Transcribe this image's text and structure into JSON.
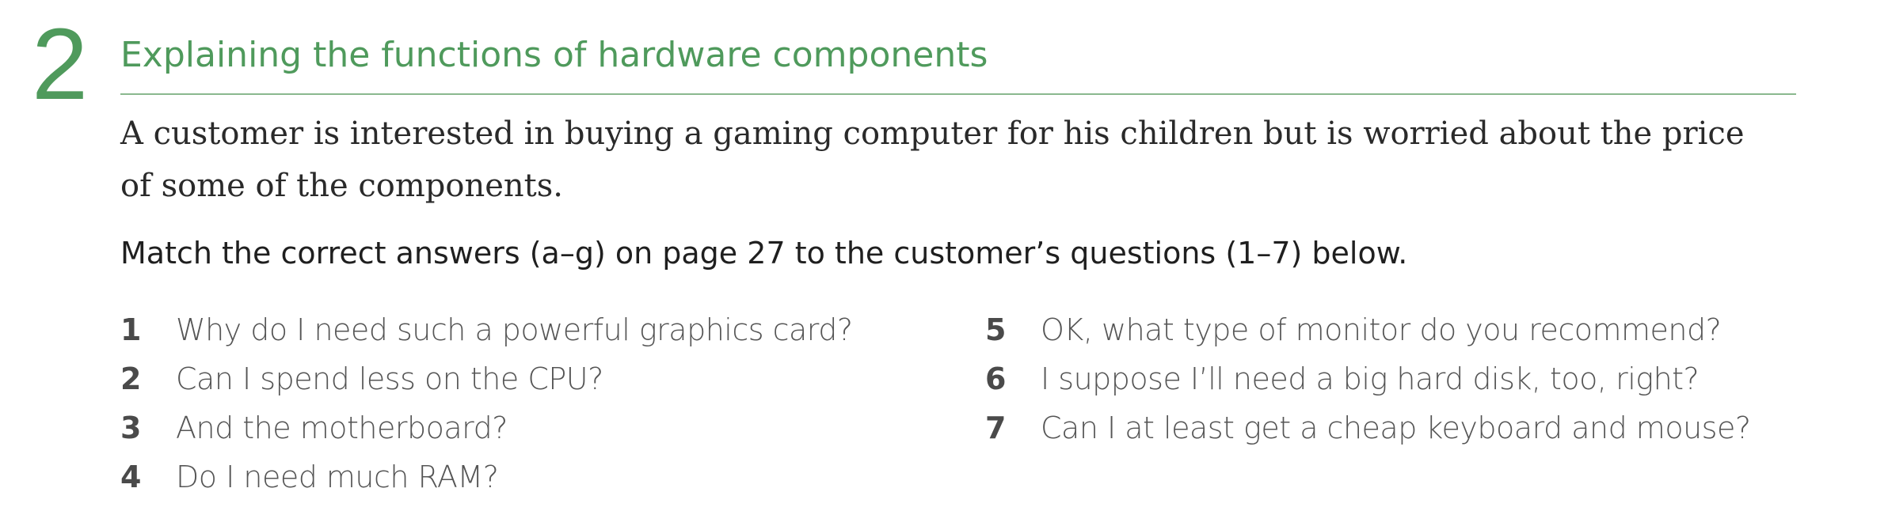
{
  "section": {
    "number": "2",
    "title": "Explaining the functions of hardware components",
    "accent_color": "#4f9a5c"
  },
  "intro": "A customer is interested in buying a gaming computer for his children but is worried about the price of some of the components.",
  "instruction": "Match the correct answers (a–g) on page 27 to the customer’s questions (1–7) below.",
  "questions_left": [
    {
      "num": "1",
      "text": "Why do I need such a powerful graphics card?"
    },
    {
      "num": "2",
      "text": "Can I spend less on the CPU?"
    },
    {
      "num": "3",
      "text": "And the motherboard?"
    },
    {
      "num": "4",
      "text": "Do I need much RAM?"
    }
  ],
  "questions_right": [
    {
      "num": "5",
      "text": "OK, what type of monitor do you recommend?"
    },
    {
      "num": "6",
      "text": "I suppose I’ll need a big hard disk, too, right?"
    },
    {
      "num": "7",
      "text": "Can I at least get a cheap keyboard and mouse?"
    }
  ]
}
